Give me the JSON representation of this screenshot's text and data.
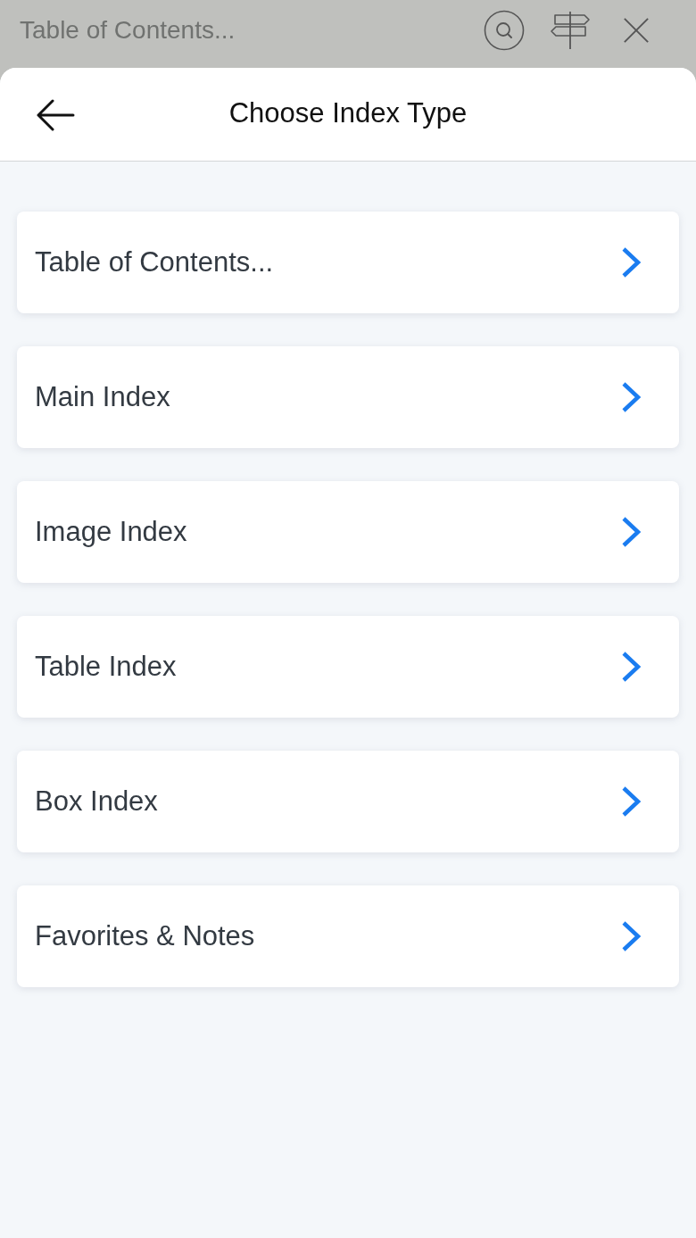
{
  "top_bar": {
    "title": "Table of Contents..."
  },
  "header": {
    "title": "Choose Index Type"
  },
  "items": [
    {
      "label": "Table of Contents..."
    },
    {
      "label": "Main Index"
    },
    {
      "label": "Image Index"
    },
    {
      "label": "Table Index"
    },
    {
      "label": "Box Index"
    },
    {
      "label": "Favorites & Notes"
    }
  ]
}
